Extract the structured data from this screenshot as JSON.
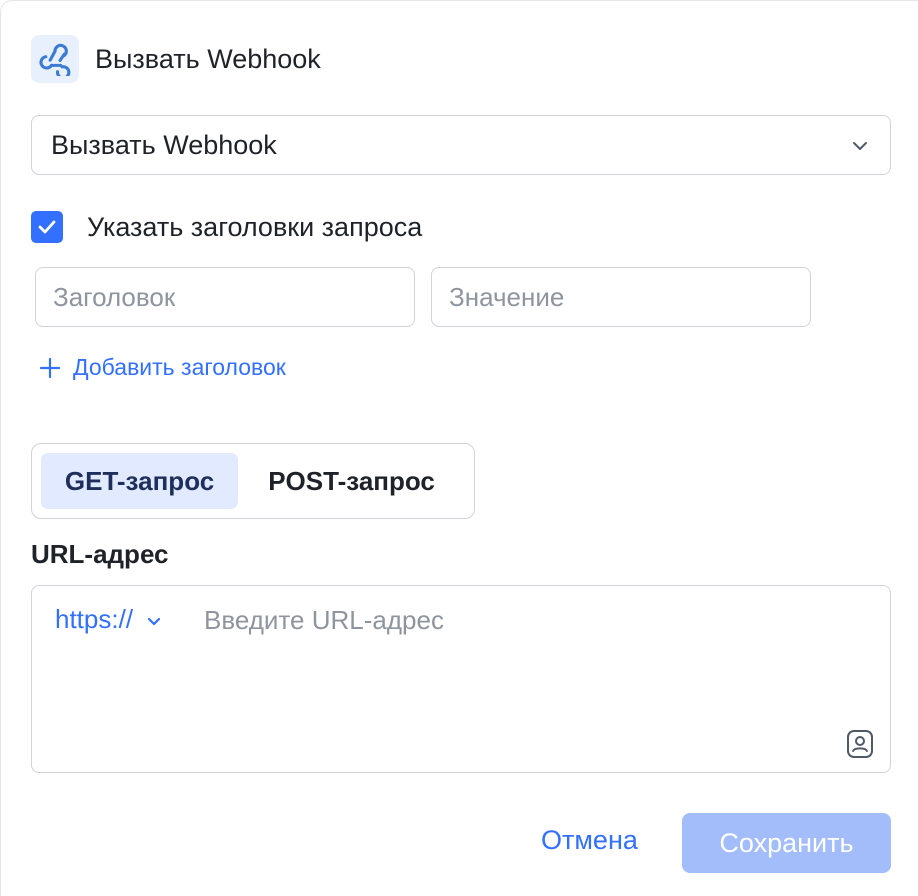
{
  "header": {
    "title": "Вызвать Webhook",
    "icon": "webhook-icon"
  },
  "action_select": {
    "value": "Вызвать Webhook"
  },
  "headers_toggle": {
    "label": "Указать заголовки запроса",
    "checked": true
  },
  "header_fields": {
    "key_placeholder": "Заголовок",
    "value_placeholder": "Значение"
  },
  "add_header": {
    "label": "Добавить заголовок"
  },
  "method_tabs": {
    "get": "GET-запрос",
    "post": "POST-запрос",
    "selected": "get"
  },
  "url": {
    "label": "URL-адрес",
    "protocol": "https://",
    "placeholder": "Введите URL-адрес"
  },
  "footer": {
    "cancel": "Отмена",
    "save": "Сохранить"
  },
  "colors": {
    "accent": "#3370ff",
    "save_disabled": "#a3bdfa",
    "tab_active_bg": "#e1eaff"
  }
}
